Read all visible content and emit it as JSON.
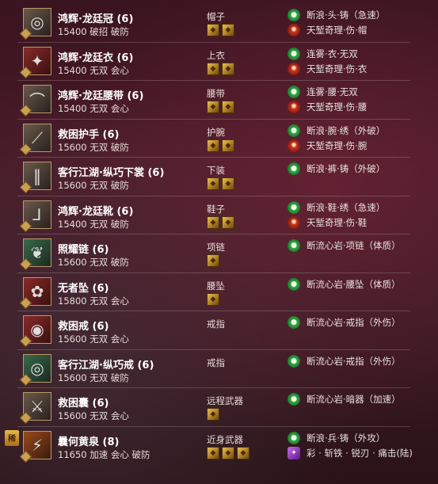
{
  "items": [
    {
      "name": "鸿辉·龙廷冠 (6)",
      "stats": "15400 破招 破防",
      "slot": "帽子",
      "icon": "hat-icon",
      "icon_glyph": "◎",
      "icon_tone": "",
      "gems": 2,
      "badge": "",
      "enchant1": "断浪·头·铸（急速）",
      "enchant1_icon": "green",
      "enchant2": "天堑奇理·伤·帽",
      "enchant2_icon": "red"
    },
    {
      "name": "鸿辉·龙廷衣 (6)",
      "stats": "15400 无双 会心",
      "slot": "上衣",
      "icon": "armor-icon",
      "icon_glyph": "✦",
      "icon_tone": "red",
      "gems": 2,
      "badge": "",
      "enchant1": "连雾·衣·无双",
      "enchant1_icon": "green",
      "enchant2": "天堑奇理·伤·衣",
      "enchant2_icon": "red"
    },
    {
      "name": "鸿辉·龙廷腰带 (6)",
      "stats": "15400 无双 会心",
      "slot": "腰带",
      "icon": "belt-icon",
      "icon_glyph": "⌒",
      "icon_tone": "",
      "gems": 2,
      "badge": "",
      "enchant1": "连雾·腰·无双",
      "enchant1_icon": "green",
      "enchant2": "天堑奇理·伤·腰",
      "enchant2_icon": "red"
    },
    {
      "name": "救困护手 (6)",
      "stats": "15600 无双 破防",
      "slot": "护腕",
      "icon": "bracer-icon",
      "icon_glyph": "⟋",
      "icon_tone": "",
      "gems": 2,
      "badge": "",
      "enchant1": "断浪·腕·绣（外破）",
      "enchant1_icon": "green",
      "enchant2": "天堑奇理·伤·腕",
      "enchant2_icon": "red"
    },
    {
      "name": "客行江湖·纵巧下裳 (6)",
      "stats": "15600 无双 破防",
      "slot": "下装",
      "icon": "pants-icon",
      "icon_glyph": "‖",
      "icon_tone": "",
      "gems": 2,
      "badge": "",
      "enchant1": "断浪·裤·铸（外破）",
      "enchant1_icon": "green",
      "enchant2": "",
      "enchant2_icon": ""
    },
    {
      "name": "鸿辉·龙廷靴 (6)",
      "stats": "15400 无双 破防",
      "slot": "鞋子",
      "icon": "boots-icon",
      "icon_glyph": "⅃",
      "icon_tone": "",
      "gems": 2,
      "badge": "",
      "enchant1": "断浪·鞋·绣（急速）",
      "enchant1_icon": "green",
      "enchant2": "天堑奇理·伤·鞋",
      "enchant2_icon": "red"
    },
    {
      "name": "照耀链 (6)",
      "stats": "15600 无双 破防",
      "slot": "项链",
      "icon": "necklace-icon",
      "icon_glyph": "❦",
      "icon_tone": "green",
      "gems": 1,
      "badge": "",
      "enchant1": "断流心岩·项链（体质）",
      "enchant1_icon": "green",
      "enchant2": "",
      "enchant2_icon": ""
    },
    {
      "name": "无者坠 (6)",
      "stats": "15800 无双 会心",
      "slot": "腰坠",
      "icon": "pendant-icon",
      "icon_glyph": "✿",
      "icon_tone": "red",
      "gems": 1,
      "badge": "",
      "enchant1": "断流心岩·腰坠（体质）",
      "enchant1_icon": "green",
      "enchant2": "",
      "enchant2_icon": ""
    },
    {
      "name": "救困戒 (6)",
      "stats": "15600 无双 会心",
      "slot": "戒指",
      "icon": "ring-icon",
      "icon_glyph": "◉",
      "icon_tone": "red",
      "gems": 0,
      "badge": "",
      "enchant1": "断流心岩·戒指（外伤）",
      "enchant1_icon": "green",
      "enchant2": "",
      "enchant2_icon": ""
    },
    {
      "name": "客行江湖·纵巧戒 (6)",
      "stats": "15600 无双 破防",
      "slot": "戒指",
      "icon": "ring-icon",
      "icon_glyph": "◎",
      "icon_tone": "green",
      "gems": 0,
      "badge": "",
      "enchant1": "断流心岩·戒指（外伤）",
      "enchant1_icon": "green",
      "enchant2": "",
      "enchant2_icon": ""
    },
    {
      "name": "救困囊 (6)",
      "stats": "15600 无双 会心",
      "slot": "远程武器",
      "icon": "quiver-icon",
      "icon_glyph": "⚔",
      "icon_tone": "",
      "gems": 1,
      "badge": "",
      "enchant1": "断流心岩·暗器（加速）",
      "enchant1_icon": "green",
      "enchant2": "",
      "enchant2_icon": ""
    },
    {
      "name": "曩何黄泉 (8)",
      "stats": "11650 加速 会心 破防",
      "slot": "近身武器",
      "icon": "blade-icon",
      "icon_glyph": "⚡",
      "icon_tone": "orange",
      "gems": 3,
      "badge": "稀",
      "enchant1": "断浪·兵·铸（外攻）",
      "enchant1_icon": "green",
      "enchant2": "彩 · 斩铁 · 锐刃 · 痛击(陆)",
      "enchant2_icon": "purple"
    }
  ]
}
